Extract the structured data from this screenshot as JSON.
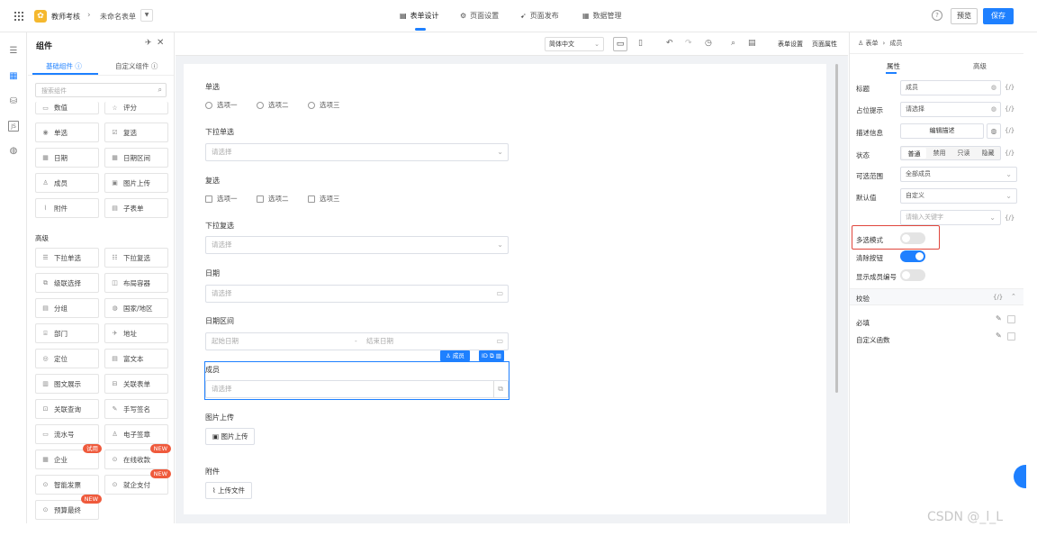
{
  "header": {
    "app_name": "教师考核",
    "form_name": "未命名表单",
    "tabs": [
      "表单设计",
      "页面设置",
      "页面发布",
      "数据管理"
    ],
    "preview_label": "预览",
    "save_label": "保存"
  },
  "palette": {
    "title": "组件",
    "tab_basic": "基础组件",
    "tab_custom": "自定义组件",
    "search_placeholder": "搜索组件",
    "basic_items": [
      "数值",
      "评分",
      "单选",
      "复选",
      "日期",
      "日期区间",
      "成员",
      "图片上传",
      "附件",
      "子表单"
    ],
    "advanced_title": "高级",
    "advanced_items": [
      "下拉单选",
      "下拉复选",
      "级联选择",
      "布局容器",
      "分组",
      "国家/地区",
      "部门",
      "地址",
      "定位",
      "富文本",
      "图文展示",
      "关联表单",
      "关联查询",
      "手写签名",
      "流水号",
      "电子签章",
      "企业",
      "在线收款",
      "智能发票",
      "就企支付",
      "预算最终"
    ],
    "badges": {
      "trial": "试用",
      "new": "NEW"
    }
  },
  "toolbar": {
    "language": "简体中文",
    "form_settings": "表单设置",
    "page_props": "页面属性"
  },
  "form": {
    "radio_label": "单选",
    "radio_options": [
      "选项一",
      "选项二",
      "选项三"
    ],
    "dropdown_single_label": "下拉单选",
    "dropdown_single_placeholder": "请选择",
    "checkbox_label": "复选",
    "checkbox_options": [
      "选项一",
      "选项二",
      "选项三"
    ],
    "dropdown_multi_label": "下拉复选",
    "dropdown_multi_placeholder": "请选择",
    "date_label": "日期",
    "date_placeholder": "请选择",
    "date_range_label": "日期区间",
    "date_range_start": "起始日期",
    "date_range_sep": "-",
    "date_range_end": "结束日期",
    "member_tag": "成员",
    "member_id_tag": "ID",
    "member_label": "成员",
    "member_placeholder": "请选择",
    "image_label": "图片上传",
    "image_button": "图片上传",
    "attach_label": "附件",
    "attach_button": "上传文件"
  },
  "props": {
    "breadcrumb_root": "表单",
    "breadcrumb_current": "成员",
    "tab_props": "属性",
    "tab_advanced": "高级",
    "title_label": "标题",
    "title_value": "成员",
    "placeholder_label": "占位提示",
    "placeholder_value": "请选择",
    "desc_label": "描述信息",
    "desc_button": "编辑描述",
    "state_label": "状态",
    "state_options": [
      "普通",
      "禁用",
      "只读",
      "隐藏"
    ],
    "range_label": "可选范围",
    "range_value": "全部成员",
    "default_label": "默认值",
    "default_value": "自定义",
    "keyword_placeholder": "请输入关键字",
    "multi_label": "多选模式",
    "multi_on": false,
    "clear_label": "清除按钮",
    "clear_on": true,
    "show_id_label": "显示成员编号",
    "show_id_on": false,
    "validate_label": "校验",
    "required_label": "必填",
    "custom_fn_label": "自定义函数",
    "fx": "{/}"
  },
  "watermark": "CSDN @_l_L",
  "colors": {
    "accent": "#1e80ff",
    "highlight": "#e0463c",
    "badge": "#ef5a3c"
  }
}
